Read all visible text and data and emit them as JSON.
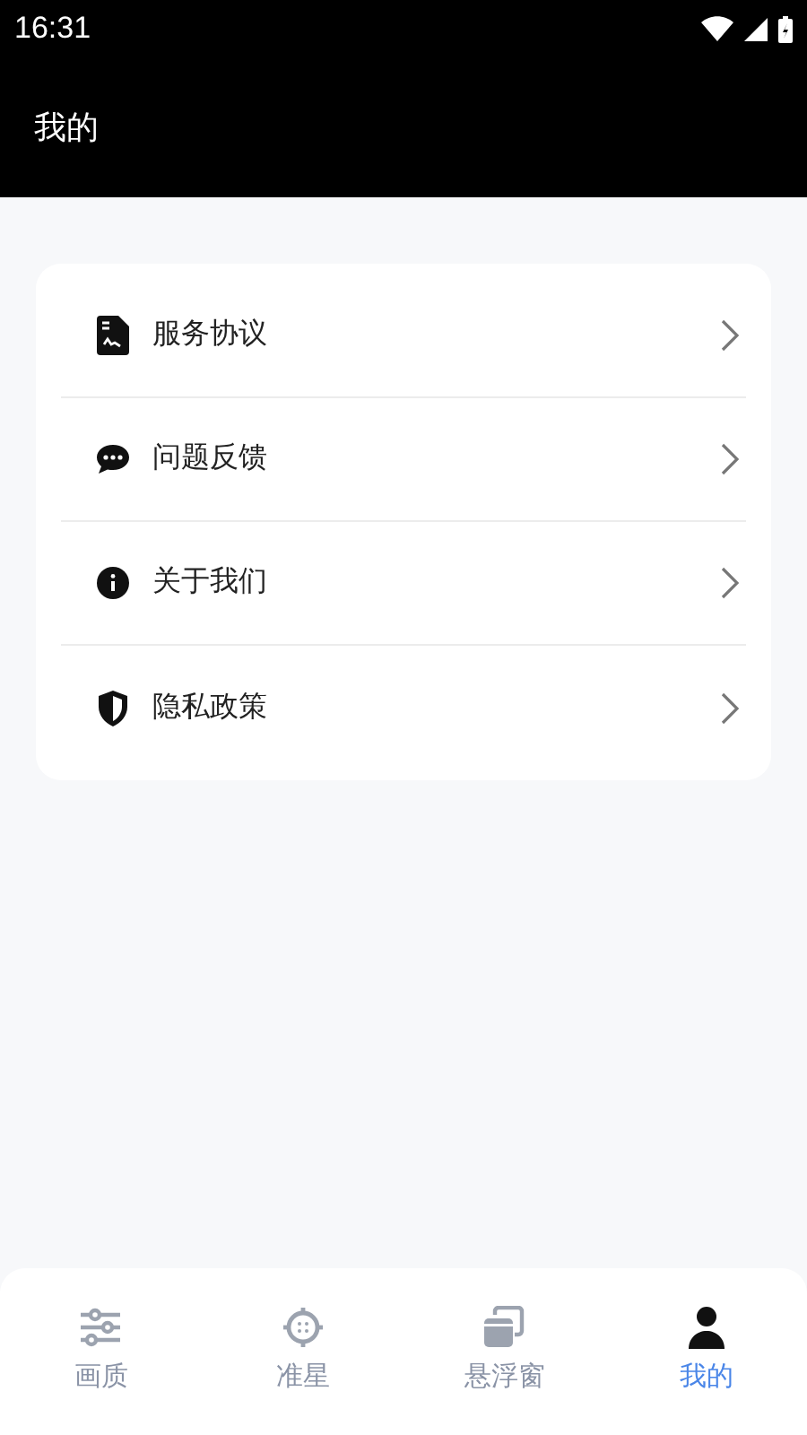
{
  "status_bar": {
    "time": "16:31"
  },
  "header": {
    "title": "我的"
  },
  "menu": [
    {
      "label": "服务协议",
      "kind": "document"
    },
    {
      "label": "问题反馈",
      "kind": "chat"
    },
    {
      "label": "关于我们",
      "kind": "info"
    },
    {
      "label": "隐私政策",
      "kind": "shield"
    }
  ],
  "tabs": [
    {
      "label": "画质",
      "kind": "sliders",
      "selected": false
    },
    {
      "label": "准星",
      "kind": "crosshair",
      "selected": false
    },
    {
      "label": "悬浮窗",
      "kind": "windows",
      "selected": false
    },
    {
      "label": "我的",
      "kind": "person",
      "selected": true
    }
  ]
}
